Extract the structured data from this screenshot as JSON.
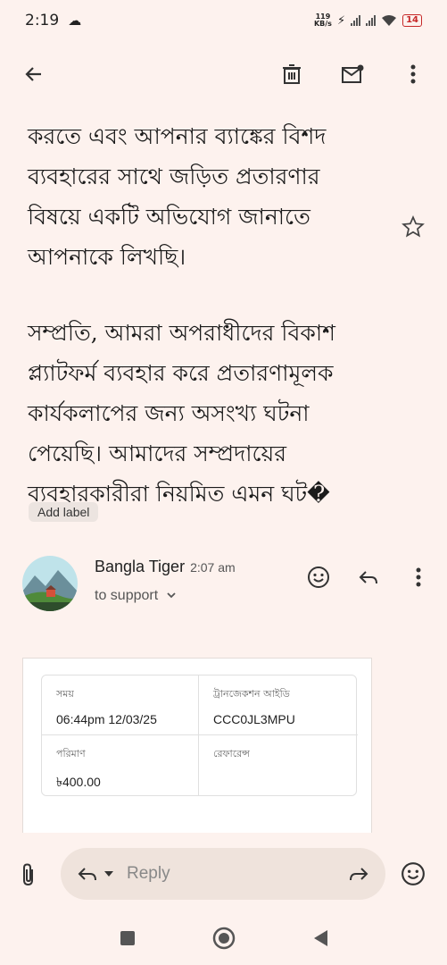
{
  "status_bar": {
    "time": "2:19",
    "network_speed_value": "119",
    "network_speed_unit": "KB/s",
    "battery": "14"
  },
  "email": {
    "paragraphs": [
      "করতে এবং আপনার ব্যাঙ্কের বিশদ\nব্যবহারের সাথে জড়িত প্রতারণার\nবিষয়ে একটি অভিযোগ জানাতে\nআপনাকে লিখছি।",
      "সম্প্রতি, আমরা অপরাধীদের বিকাশ\nপ্ল্যাটফর্ম ব্যবহার করে প্রতারণামূলক\nকার্যকলাপের জন্য অসংখ্য ঘটনা\nপেয়েছি। আমাদের সম্প্রদায়ের\nব্যবহারকারীরা নিয়মিত এমন ঘট�"
    ],
    "add_label": "Add label"
  },
  "sender": {
    "name": "Bangla Tiger",
    "time": "2:07 am",
    "to": "to support"
  },
  "transaction": {
    "time_label": "সময়",
    "time_value": "06:44pm 12/03/25",
    "txn_id_label": "ট্রানজেকশন আইডি",
    "txn_id_value": "CCC0JL3MPU",
    "amount_label": "পরিমাণ",
    "amount_value": "৳400.00",
    "reference_label": "রেফারেন্স",
    "reference_value": ""
  },
  "composer": {
    "placeholder": "Reply"
  },
  "colors": {
    "background": "#fdf2ee",
    "battery_low": "#c62828"
  }
}
